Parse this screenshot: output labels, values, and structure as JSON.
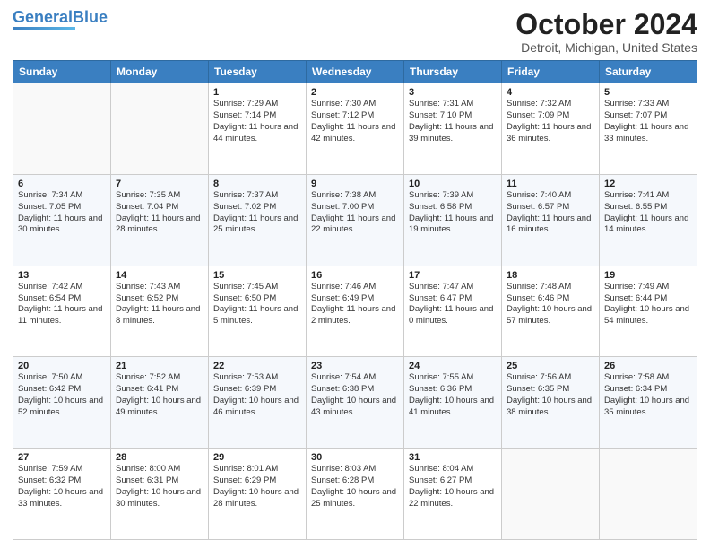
{
  "header": {
    "logo_general": "General",
    "logo_blue": "Blue",
    "title": "October 2024",
    "subtitle": "Detroit, Michigan, United States"
  },
  "calendar": {
    "weekdays": [
      "Sunday",
      "Monday",
      "Tuesday",
      "Wednesday",
      "Thursday",
      "Friday",
      "Saturday"
    ],
    "weeks": [
      [
        {
          "day": "",
          "text": ""
        },
        {
          "day": "",
          "text": ""
        },
        {
          "day": "1",
          "text": "Sunrise: 7:29 AM\nSunset: 7:14 PM\nDaylight: 11 hours and 44 minutes."
        },
        {
          "day": "2",
          "text": "Sunrise: 7:30 AM\nSunset: 7:12 PM\nDaylight: 11 hours and 42 minutes."
        },
        {
          "day": "3",
          "text": "Sunrise: 7:31 AM\nSunset: 7:10 PM\nDaylight: 11 hours and 39 minutes."
        },
        {
          "day": "4",
          "text": "Sunrise: 7:32 AM\nSunset: 7:09 PM\nDaylight: 11 hours and 36 minutes."
        },
        {
          "day": "5",
          "text": "Sunrise: 7:33 AM\nSunset: 7:07 PM\nDaylight: 11 hours and 33 minutes."
        }
      ],
      [
        {
          "day": "6",
          "text": "Sunrise: 7:34 AM\nSunset: 7:05 PM\nDaylight: 11 hours and 30 minutes."
        },
        {
          "day": "7",
          "text": "Sunrise: 7:35 AM\nSunset: 7:04 PM\nDaylight: 11 hours and 28 minutes."
        },
        {
          "day": "8",
          "text": "Sunrise: 7:37 AM\nSunset: 7:02 PM\nDaylight: 11 hours and 25 minutes."
        },
        {
          "day": "9",
          "text": "Sunrise: 7:38 AM\nSunset: 7:00 PM\nDaylight: 11 hours and 22 minutes."
        },
        {
          "day": "10",
          "text": "Sunrise: 7:39 AM\nSunset: 6:58 PM\nDaylight: 11 hours and 19 minutes."
        },
        {
          "day": "11",
          "text": "Sunrise: 7:40 AM\nSunset: 6:57 PM\nDaylight: 11 hours and 16 minutes."
        },
        {
          "day": "12",
          "text": "Sunrise: 7:41 AM\nSunset: 6:55 PM\nDaylight: 11 hours and 14 minutes."
        }
      ],
      [
        {
          "day": "13",
          "text": "Sunrise: 7:42 AM\nSunset: 6:54 PM\nDaylight: 11 hours and 11 minutes."
        },
        {
          "day": "14",
          "text": "Sunrise: 7:43 AM\nSunset: 6:52 PM\nDaylight: 11 hours and 8 minutes."
        },
        {
          "day": "15",
          "text": "Sunrise: 7:45 AM\nSunset: 6:50 PM\nDaylight: 11 hours and 5 minutes."
        },
        {
          "day": "16",
          "text": "Sunrise: 7:46 AM\nSunset: 6:49 PM\nDaylight: 11 hours and 2 minutes."
        },
        {
          "day": "17",
          "text": "Sunrise: 7:47 AM\nSunset: 6:47 PM\nDaylight: 11 hours and 0 minutes."
        },
        {
          "day": "18",
          "text": "Sunrise: 7:48 AM\nSunset: 6:46 PM\nDaylight: 10 hours and 57 minutes."
        },
        {
          "day": "19",
          "text": "Sunrise: 7:49 AM\nSunset: 6:44 PM\nDaylight: 10 hours and 54 minutes."
        }
      ],
      [
        {
          "day": "20",
          "text": "Sunrise: 7:50 AM\nSunset: 6:42 PM\nDaylight: 10 hours and 52 minutes."
        },
        {
          "day": "21",
          "text": "Sunrise: 7:52 AM\nSunset: 6:41 PM\nDaylight: 10 hours and 49 minutes."
        },
        {
          "day": "22",
          "text": "Sunrise: 7:53 AM\nSunset: 6:39 PM\nDaylight: 10 hours and 46 minutes."
        },
        {
          "day": "23",
          "text": "Sunrise: 7:54 AM\nSunset: 6:38 PM\nDaylight: 10 hours and 43 minutes."
        },
        {
          "day": "24",
          "text": "Sunrise: 7:55 AM\nSunset: 6:36 PM\nDaylight: 10 hours and 41 minutes."
        },
        {
          "day": "25",
          "text": "Sunrise: 7:56 AM\nSunset: 6:35 PM\nDaylight: 10 hours and 38 minutes."
        },
        {
          "day": "26",
          "text": "Sunrise: 7:58 AM\nSunset: 6:34 PM\nDaylight: 10 hours and 35 minutes."
        }
      ],
      [
        {
          "day": "27",
          "text": "Sunrise: 7:59 AM\nSunset: 6:32 PM\nDaylight: 10 hours and 33 minutes."
        },
        {
          "day": "28",
          "text": "Sunrise: 8:00 AM\nSunset: 6:31 PM\nDaylight: 10 hours and 30 minutes."
        },
        {
          "day": "29",
          "text": "Sunrise: 8:01 AM\nSunset: 6:29 PM\nDaylight: 10 hours and 28 minutes."
        },
        {
          "day": "30",
          "text": "Sunrise: 8:03 AM\nSunset: 6:28 PM\nDaylight: 10 hours and 25 minutes."
        },
        {
          "day": "31",
          "text": "Sunrise: 8:04 AM\nSunset: 6:27 PM\nDaylight: 10 hours and 22 minutes."
        },
        {
          "day": "",
          "text": ""
        },
        {
          "day": "",
          "text": ""
        }
      ]
    ]
  }
}
